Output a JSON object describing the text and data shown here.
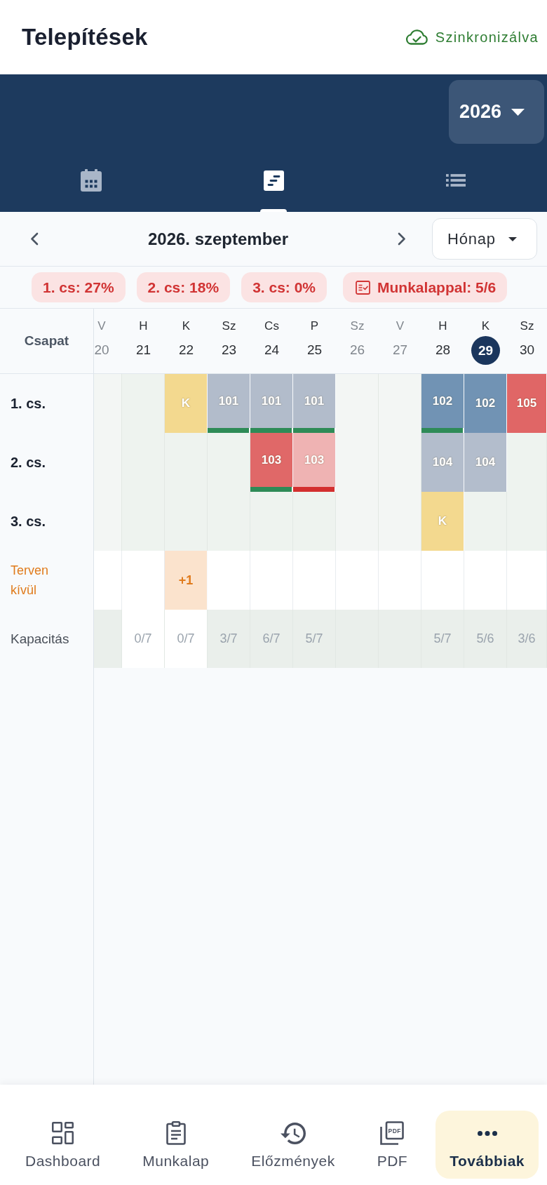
{
  "header": {
    "title": "Telepítések",
    "sync_status": "Szinkronizálva"
  },
  "year_selector": {
    "value": "2026"
  },
  "view_tabs": [
    {
      "kind": "calendar",
      "selected": false
    },
    {
      "kind": "timeline",
      "selected": true
    },
    {
      "kind": "list",
      "selected": false
    }
  ],
  "month_nav": {
    "title": "2026. szeptember",
    "view_mode": "Hónap"
  },
  "summary_chips": [
    {
      "kind": "team",
      "label": "1. cs: 27%"
    },
    {
      "kind": "team",
      "label": "2. cs: 18%"
    },
    {
      "kind": "team",
      "label": "3. cs: 0%"
    },
    {
      "kind": "worksheet",
      "label": "Munkalappal: 5/6"
    }
  ],
  "schedule": {
    "corner_label": "Csapat",
    "days": [
      {
        "weekday": "V",
        "day": "20",
        "weekend": true,
        "today": false
      },
      {
        "weekday": "H",
        "day": "21",
        "weekend": false,
        "today": false
      },
      {
        "weekday": "K",
        "day": "22",
        "weekend": false,
        "today": false
      },
      {
        "weekday": "Sz",
        "day": "23",
        "weekend": false,
        "today": false
      },
      {
        "weekday": "Cs",
        "day": "24",
        "weekend": false,
        "today": false
      },
      {
        "weekday": "P",
        "day": "25",
        "weekend": false,
        "today": false
      },
      {
        "weekday": "Sz",
        "day": "26",
        "weekend": true,
        "today": false
      },
      {
        "weekday": "V",
        "day": "27",
        "weekend": true,
        "today": false
      },
      {
        "weekday": "H",
        "day": "28",
        "weekend": false,
        "today": false
      },
      {
        "weekday": "K",
        "day": "29",
        "weekend": false,
        "today": true
      },
      {
        "weekday": "Sz",
        "day": "30",
        "weekend": false,
        "today": false
      }
    ],
    "rows": [
      {
        "kind": "team",
        "label": "1. cs.",
        "cells": [
          {
            "kind": "empty"
          },
          {
            "kind": "empty"
          },
          {
            "kind": "job",
            "text": "K",
            "color": "#f3d98f"
          },
          {
            "kind": "job",
            "text": "101",
            "color": "#b2bccb",
            "strip": {
              "color": "#2e8b57"
            }
          },
          {
            "kind": "job",
            "text": "101",
            "color": "#b2bccb",
            "strip": {
              "color": "#2e8b57"
            }
          },
          {
            "kind": "job",
            "text": "101",
            "color": "#b2bccb",
            "strip": {
              "color": "#2e8b57"
            }
          },
          {
            "kind": "empty"
          },
          {
            "kind": "empty"
          },
          {
            "kind": "job",
            "text": "102",
            "color": "#7193b4",
            "strip": {
              "color": "#2e8b57"
            }
          },
          {
            "kind": "job",
            "text": "102",
            "color": "#7193b4"
          },
          {
            "kind": "job",
            "text": "105",
            "color": "#e06666"
          }
        ]
      },
      {
        "kind": "team",
        "label": "2. cs.",
        "cells": [
          {
            "kind": "empty"
          },
          {
            "kind": "empty"
          },
          {
            "kind": "empty"
          },
          {
            "kind": "empty"
          },
          {
            "kind": "job",
            "text": "103",
            "color": "#e06868",
            "strip": {
              "color": "#2e8b57"
            }
          },
          {
            "kind": "job",
            "text": "103",
            "color": "#efb3b3",
            "strip": {
              "color": "#d32f2f"
            }
          },
          {
            "kind": "empty"
          },
          {
            "kind": "empty"
          },
          {
            "kind": "job",
            "text": "104",
            "color": "#b3bdcc"
          },
          {
            "kind": "job",
            "text": "104",
            "color": "#b3bdcc"
          },
          {
            "kind": "empty"
          }
        ]
      },
      {
        "kind": "team",
        "label": "3. cs.",
        "cells": [
          {
            "kind": "empty"
          },
          {
            "kind": "empty"
          },
          {
            "kind": "empty"
          },
          {
            "kind": "empty"
          },
          {
            "kind": "empty"
          },
          {
            "kind": "empty"
          },
          {
            "kind": "empty"
          },
          {
            "kind": "empty"
          },
          {
            "kind": "job",
            "text": "K",
            "color": "#f3d98f"
          },
          {
            "kind": "empty"
          },
          {
            "kind": "empty"
          }
        ]
      },
      {
        "kind": "unplanned",
        "label": "Terven kívül",
        "cells": [
          {
            "kind": "empty"
          },
          {
            "kind": "empty"
          },
          {
            "kind": "extra",
            "text": "+1",
            "color": "#fbe3cd"
          },
          {
            "kind": "empty"
          },
          {
            "kind": "empty"
          },
          {
            "kind": "empty"
          },
          {
            "kind": "empty"
          },
          {
            "kind": "empty"
          },
          {
            "kind": "empty"
          },
          {
            "kind": "empty"
          },
          {
            "kind": "empty"
          }
        ]
      },
      {
        "kind": "capacity",
        "label": "Kapacitás",
        "cells": [
          {
            "kind": "capacity",
            "shaded": true
          },
          {
            "kind": "capacity",
            "text": "0/7",
            "shaded": false
          },
          {
            "kind": "capacity",
            "text": "0/7",
            "shaded": false
          },
          {
            "kind": "capacity",
            "text": "3/7",
            "shaded": true
          },
          {
            "kind": "capacity",
            "text": "6/7",
            "shaded": true
          },
          {
            "kind": "capacity",
            "text": "5/7",
            "shaded": true
          },
          {
            "kind": "capacity",
            "shaded": true
          },
          {
            "kind": "capacity",
            "shaded": true
          },
          {
            "kind": "capacity",
            "text": "5/7",
            "shaded": true
          },
          {
            "kind": "capacity",
            "text": "5/6",
            "shaded": true
          },
          {
            "kind": "capacity",
            "text": "3/6",
            "shaded": true
          }
        ]
      }
    ]
  },
  "bottom_nav": [
    {
      "kind": "dashboard",
      "label": "Dashboard",
      "selected": false
    },
    {
      "kind": "worksheet",
      "label": "Munkalap",
      "selected": false
    },
    {
      "kind": "history",
      "label": "Előzmények",
      "selected": false
    },
    {
      "kind": "pdf",
      "icon_text": "PDF",
      "label": "PDF",
      "selected": false
    },
    {
      "kind": "more",
      "label": "Továbbiak",
      "selected": true
    }
  ]
}
